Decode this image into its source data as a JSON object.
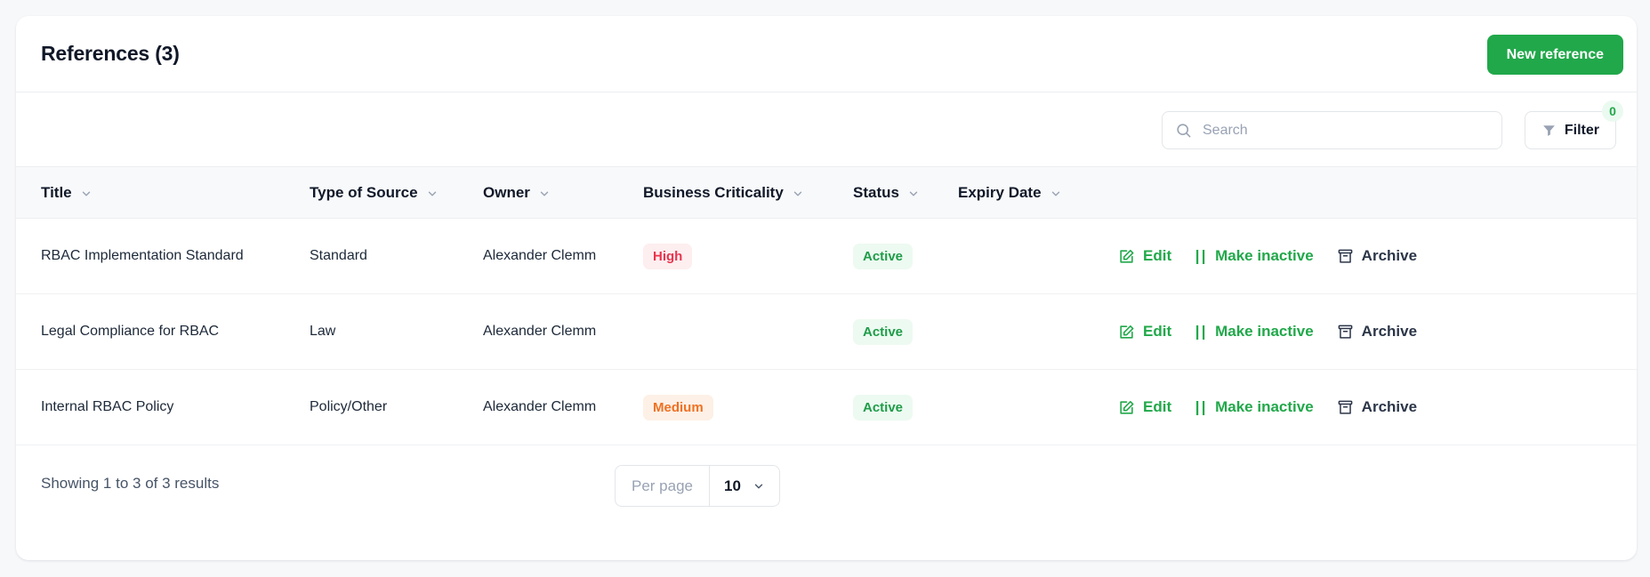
{
  "card": {
    "title": "References (3)",
    "new_button": "New reference"
  },
  "toolbar": {
    "search_placeholder": "Search",
    "search_value": "",
    "filter_label": "Filter",
    "filter_count": "0"
  },
  "table": {
    "columns": [
      {
        "label": "Title"
      },
      {
        "label": "Type of Source"
      },
      {
        "label": "Owner"
      },
      {
        "label": "Business Criticality"
      },
      {
        "label": "Status"
      },
      {
        "label": "Expiry Date"
      }
    ],
    "rows": [
      {
        "title": "RBAC Implementation Standard",
        "type": "Standard",
        "owner": "Alexander Clemm",
        "criticality": "High",
        "status": "Active",
        "expiry": "",
        "actions": {
          "edit": "Edit",
          "make_inactive": "Make inactive",
          "archive": "Archive"
        }
      },
      {
        "title": "Legal Compliance for RBAC",
        "type": "Law",
        "owner": "Alexander Clemm",
        "criticality": "",
        "status": "Active",
        "expiry": "",
        "actions": {
          "edit": "Edit",
          "make_inactive": "Make inactive",
          "archive": "Archive"
        }
      },
      {
        "title": "Internal RBAC Policy",
        "type": "Policy/Other",
        "owner": "Alexander Clemm",
        "criticality": "Medium",
        "status": "Active",
        "expiry": "",
        "actions": {
          "edit": "Edit",
          "make_inactive": "Make inactive",
          "archive": "Archive"
        }
      }
    ]
  },
  "footer": {
    "results_text": "Showing 1 to 3 of 3 results",
    "per_page_label": "Per page",
    "per_page_value": "10"
  },
  "colors": {
    "accent_green": "#21a84a",
    "badge_high_text": "#e8344e",
    "badge_high_bg": "#fdeef0",
    "badge_medium_text": "#ef7122",
    "badge_medium_bg": "#fdf0e6",
    "badge_active_text": "#1f9c49",
    "badge_active_bg": "#edfaf1",
    "page_bg": "#f7f8fa"
  }
}
